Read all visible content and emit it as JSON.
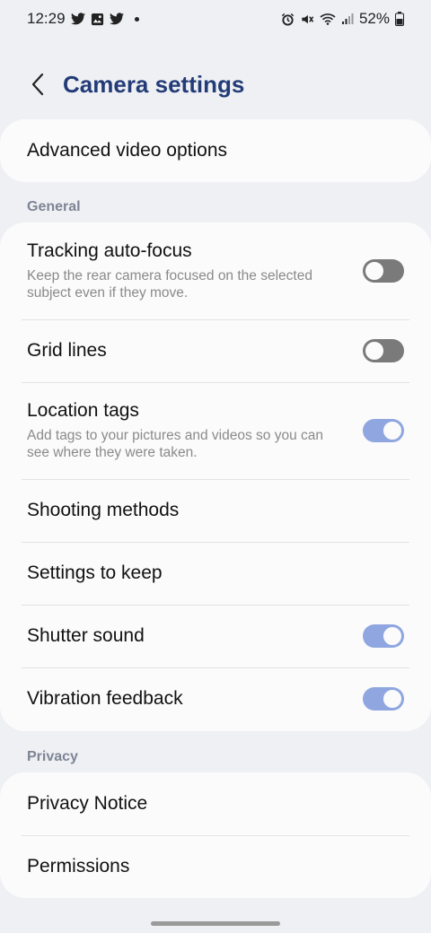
{
  "status_bar": {
    "time": "12:29",
    "battery": "52%",
    "left_icons": [
      "twitter-icon",
      "gallery-icon",
      "twitter-icon"
    ],
    "right_icons": [
      "alarm-icon",
      "mute-icon",
      "wifi-icon",
      "signal-icon",
      "battery-icon"
    ]
  },
  "header": {
    "title": "Camera settings"
  },
  "advanced": {
    "label": "Advanced video options"
  },
  "sections": {
    "general": "General",
    "privacy": "Privacy"
  },
  "general_items": [
    {
      "title": "Tracking auto-focus",
      "subtitle": "Keep the rear camera focused on the selected subject even if they move.",
      "toggle": "off"
    },
    {
      "title": "Grid lines",
      "toggle": "off"
    },
    {
      "title": "Location tags",
      "subtitle": "Add tags to your pictures and videos so you can see where they were taken.",
      "toggle": "on"
    },
    {
      "title": "Shooting methods"
    },
    {
      "title": "Settings to keep"
    },
    {
      "title": "Shutter sound",
      "toggle": "on"
    },
    {
      "title": "Vibration feedback",
      "toggle": "on"
    }
  ],
  "privacy_items": [
    {
      "title": "Privacy Notice"
    },
    {
      "title": "Permissions"
    }
  ],
  "colors": {
    "background": "#eff0f4",
    "card": "#fbfbfb",
    "title": "#233c78",
    "toggle_on": "#8fa6e0",
    "toggle_off": "#7a7a7a"
  }
}
